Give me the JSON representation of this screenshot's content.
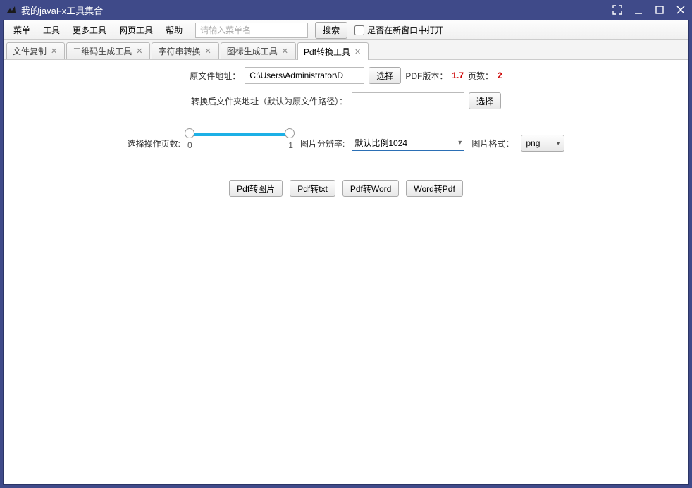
{
  "window": {
    "title": "我的javaFx工具集合"
  },
  "menubar": {
    "items": [
      "菜单",
      "工具",
      "更多工具",
      "网页工具",
      "帮助"
    ],
    "search_placeholder": "请输入菜单名",
    "search_btn": "搜索",
    "checkbox_label": "是否在新窗口中打开"
  },
  "tabs": [
    {
      "label": "文件复制"
    },
    {
      "label": "二维码生成工具"
    },
    {
      "label": "字符串转换"
    },
    {
      "label": "图标生成工具"
    },
    {
      "label": "Pdf转换工具",
      "active": true
    }
  ],
  "form": {
    "src_label": "原文件地址：",
    "src_value": "C:\\Users\\Administrator\\D",
    "choose_btn": "选择",
    "pdf_version_label": "PDF版本：",
    "pdf_version_value": "1.7",
    "pages_label": "页数：",
    "pages_value": "2",
    "dest_label": "转换后文件夹地址（默认为原文件路径）：",
    "dest_value": "",
    "dest_choose_btn": "选择",
    "page_select_label": "选择操作页数:",
    "slider_min": "0",
    "slider_max": "1",
    "resolution_label": "图片分辨率:",
    "resolution_value": "默认比例1024",
    "format_label": "图片格式：",
    "format_value": "png"
  },
  "actions": {
    "pdf_to_img": "Pdf转图片",
    "pdf_to_txt": "Pdf转txt",
    "pdf_to_word": "Pdf转Word",
    "word_to_pdf": "Word转Pdf"
  }
}
